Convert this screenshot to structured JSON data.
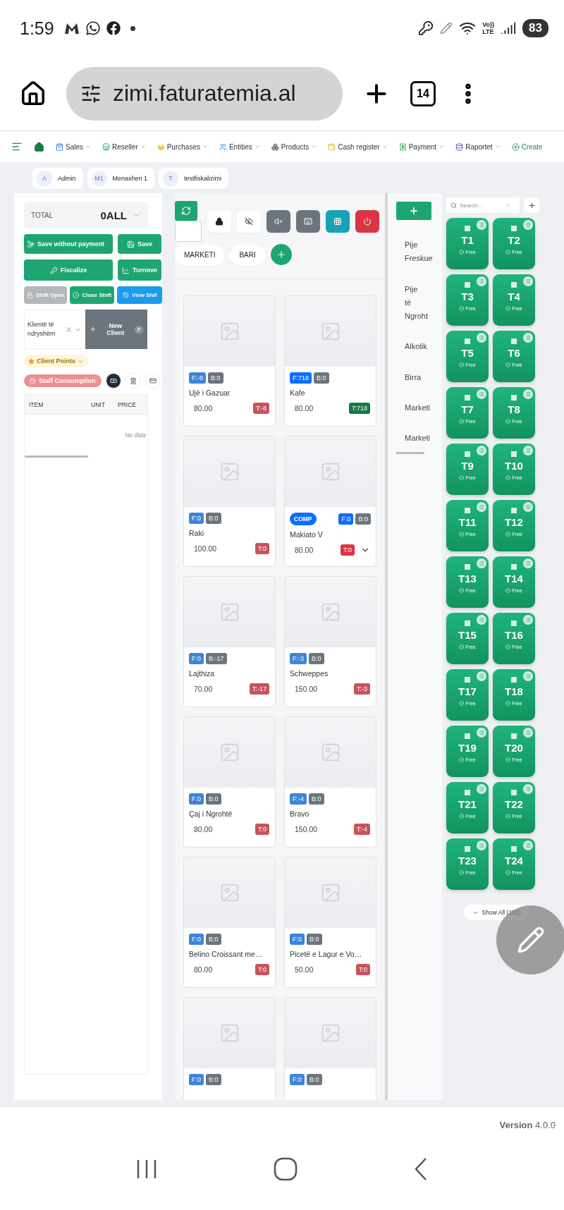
{
  "phone_status": {
    "time": "1:59",
    "network": [
      "Vo))",
      "LTE"
    ],
    "battery": "83"
  },
  "browser": {
    "url": "zimi.faturatemia.al",
    "tab_count": "14"
  },
  "nav": {
    "items": [
      "Sales",
      "Reseller",
      "Purchases",
      "Entities",
      "Products",
      "Cash register",
      "Payment",
      "Raportet",
      "Create"
    ]
  },
  "users": [
    {
      "initials": "A",
      "name": "Admin"
    },
    {
      "initials": "M1",
      "name": "Menaxheri 1"
    },
    {
      "initials": "T",
      "name": "testfiskalizimi"
    }
  ],
  "order": {
    "total_label": "TOTAL",
    "total": "0ALL",
    "actions": [
      {
        "label": "Save without payment",
        "kind": "payout"
      },
      {
        "label": "Save",
        "kind": "save"
      },
      {
        "label": "Fiscalize",
        "kind": "fiscal"
      },
      {
        "label": "Turnove",
        "kind": "chart"
      }
    ],
    "shift": [
      {
        "label": "Shift Open",
        "kind": "open",
        "disabled": true
      },
      {
        "label": "Close Shift",
        "kind": "close",
        "disabled": false
      },
      {
        "label": "View Shif",
        "kind": "view",
        "disabled": false
      }
    ],
    "client": {
      "value": "Klientë të ndryshëm",
      "new_label": "New Client",
      "new_count": "7"
    },
    "client_points": "Client Points",
    "staff": "Staff Consumption",
    "payment_modes": [
      {
        "selected": true
      },
      {
        "selected": false
      },
      {
        "selected": false
      }
    ],
    "columns": [
      "ITEM",
      "UNIT",
      "PRICE"
    ],
    "empty": "No data"
  },
  "categories": [
    {
      "label": "MARKETI"
    },
    {
      "label": "BARI"
    }
  ],
  "products": [
    {
      "name": "Ujë i Gazuar",
      "price": "80.00",
      "f": {
        "text": "F:-8",
        "color": "#3d85d8"
      },
      "b": "B:0",
      "t": {
        "text": "T:-8",
        "color": "#c9535c"
      },
      "expandable": false
    },
    {
      "name": "Kafe",
      "price": "80.00",
      "f": {
        "text": "F:718",
        "color": "#0d6efd"
      },
      "b": "B:0",
      "t": {
        "text": "T:718",
        "color": "#167a45"
      },
      "expandable": false
    },
    {
      "name": "Raki",
      "price": "100.00",
      "f": {
        "text": "F:0",
        "color": "#3d85d8"
      },
      "b": "B:0",
      "t": {
        "text": "T:0",
        "color": "#c9535c"
      },
      "expandable": false
    },
    {
      "name": "Makiato V",
      "price": "80.00",
      "comp": "COMP",
      "f": {
        "text": "F:0",
        "color": "#0d6efd"
      },
      "b": "B:0",
      "t": {
        "text": "T:0",
        "color": "#dc3545"
      },
      "expandable": true
    },
    {
      "name": "Lajthiza",
      "price": "70.00",
      "f": {
        "text": "F:0",
        "color": "#3d85d8"
      },
      "b": "B:-17",
      "t": {
        "text": "T:-17",
        "color": "#c9535c"
      },
      "expandable": false
    },
    {
      "name": "Schweppes",
      "price": "150.00",
      "f": {
        "text": "F:-3",
        "color": "#3d85d8"
      },
      "b": "B:0",
      "t": {
        "text": "T:-3",
        "color": "#c9535c"
      },
      "expandable": false
    },
    {
      "name": "Çaj i Ngrohtë",
      "price": "80.00",
      "f": {
        "text": "F:0",
        "color": "#3d85d8"
      },
      "b": "B:0",
      "t": {
        "text": "T:0",
        "color": "#c9535c"
      },
      "expandable": false
    },
    {
      "name": "Bravo",
      "price": "150.00",
      "f": {
        "text": "F:-4",
        "color": "#3d85d8"
      },
      "b": "B:0",
      "t": {
        "text": "T:-4",
        "color": "#c9535c"
      },
      "expandable": false
    },
    {
      "name": "Belino Croissant me…",
      "price": "80.00",
      "f": {
        "text": "F:0",
        "color": "#3d85d8"
      },
      "b": "B:0",
      "t": {
        "text": "T:0",
        "color": "#c9535c"
      },
      "expandable": false
    },
    {
      "name": "Picetë e Lagur e Vo…",
      "price": "50.00",
      "f": {
        "text": "F:0",
        "color": "#3d85d8"
      },
      "b": "B:0",
      "t": {
        "text": "T:0",
        "color": "#c9535c"
      },
      "expandable": false
    },
    {
      "f": {
        "text": "F:0",
        "color": "#3d85d8"
      },
      "b": "B:0"
    },
    {
      "f": {
        "text": "F:0",
        "color": "#3d85d8"
      },
      "b": "B:0"
    }
  ],
  "groups": [
    "Pije Freskue",
    "Pije të Ngroht",
    "Alkolik",
    "Birra",
    "Marketi",
    "Marketi"
  ],
  "tables": {
    "search_placeholder": "Search...",
    "items": [
      {
        "name": "T1",
        "status": "Free"
      },
      {
        "name": "T2",
        "status": "Free"
      },
      {
        "name": "T3",
        "status": "Free"
      },
      {
        "name": "T4",
        "status": "Free"
      },
      {
        "name": "T5",
        "status": "Free"
      },
      {
        "name": "T6",
        "status": "Free"
      },
      {
        "name": "T7",
        "status": "Free"
      },
      {
        "name": "T8",
        "status": "Free"
      },
      {
        "name": "T9",
        "status": "Free"
      },
      {
        "name": "T10",
        "status": "Free"
      },
      {
        "name": "T11",
        "status": "Free"
      },
      {
        "name": "T12",
        "status": "Free"
      },
      {
        "name": "T13",
        "status": "Free"
      },
      {
        "name": "T14",
        "status": "Free"
      },
      {
        "name": "T15",
        "status": "Free"
      },
      {
        "name": "T16",
        "status": "Free"
      },
      {
        "name": "T17",
        "status": "Free"
      },
      {
        "name": "T18",
        "status": "Free"
      },
      {
        "name": "T19",
        "status": "Free"
      },
      {
        "name": "T20",
        "status": "Free"
      },
      {
        "name": "T21",
        "status": "Free"
      },
      {
        "name": "T22",
        "status": "Free"
      },
      {
        "name": "T23",
        "status": "Free"
      },
      {
        "name": "T24",
        "status": "Free"
      }
    ],
    "show_all": "Show All (102)"
  },
  "version": "**Version** 4.0.0"
}
